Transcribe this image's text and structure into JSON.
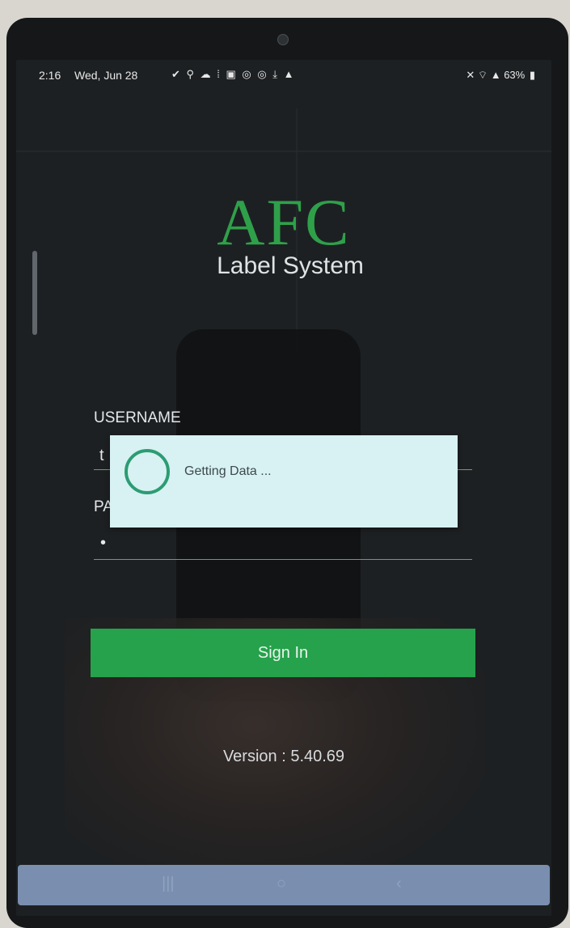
{
  "status_bar": {
    "time": "2:16",
    "date": "Wed, Jun 28",
    "notification_icons": "✔ ⚲ ☁ ⁞ ▣ ◎ ◎ ⤓ ▲",
    "system_icons": "✕ ⌔ ▲",
    "battery": "63%"
  },
  "app": {
    "logo_title": "AFC",
    "logo_subtitle": "Label System",
    "accent_color": "#25a24b"
  },
  "form": {
    "username_label": "USERNAME",
    "username_value": "t",
    "password_label": "PA",
    "password_value": "•",
    "sign_in_label": "Sign In"
  },
  "dialog": {
    "message": "Getting Data ..."
  },
  "version": "Version : 5.40.69",
  "navbar": {
    "recents": "|||",
    "home": "○",
    "back": "‹"
  }
}
